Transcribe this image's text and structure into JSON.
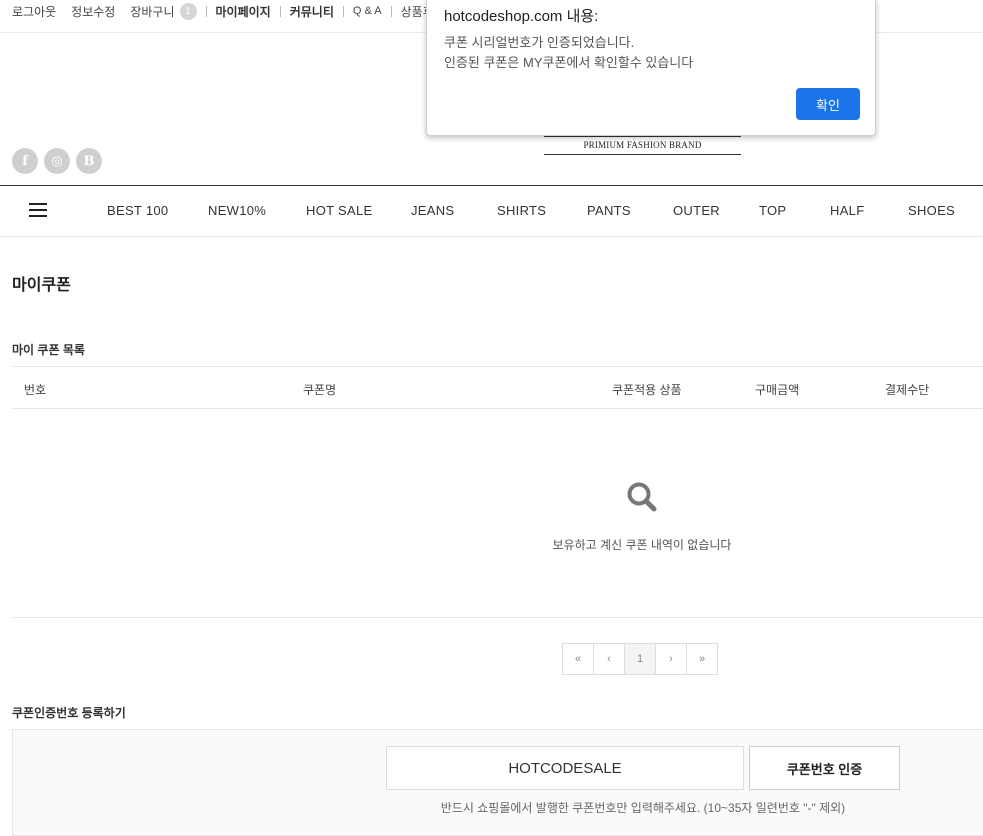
{
  "topbar": {
    "logout": "로그아웃",
    "edit_info": "정보수정",
    "cart": "장바구니",
    "cart_count": "1",
    "mypage": "마이페이지",
    "community": "커뮤니티",
    "qna": "Q & A",
    "product_partial": "상품후"
  },
  "header": {
    "social": [
      "f",
      "◎",
      "B"
    ],
    "brand_tagline": "PRIMIUM FASHION BRAND"
  },
  "nav": {
    "items": [
      "BEST 100",
      "NEW10%",
      "HOT SALE",
      "JEANS",
      "SHIRTS",
      "PANTS",
      "OUTER",
      "TOP",
      "HALF",
      "SHOES"
    ]
  },
  "page": {
    "title": "마이쿠폰",
    "list_title": "마이 쿠폰 목록",
    "columns": [
      "번호",
      "쿠폰명",
      "쿠폰적용 상품",
      "구매금액",
      "결제수단"
    ],
    "empty_message": "보유하고 계신 쿠폰 내역이 없습니다"
  },
  "pagination": {
    "first": "«",
    "prev": "‹",
    "current": "1",
    "next": "›",
    "last": "»"
  },
  "register": {
    "title": "쿠폰인증번호 등록하기",
    "input_value": "HOTCODESALE",
    "button_label": "쿠폰번호 인증",
    "note": "반드시 쇼핑몰에서 발행한 쿠폰번호만 입력해주세요. (10~35자 일련번호 \"-\" 제외)"
  },
  "dialog": {
    "title": "hotcodeshop.com 내용:",
    "line1": "쿠폰 시리얼번호가 인증되었습니다.",
    "line2": "인증된 쿠폰은 MY쿠폰에서 확인할수 있습니다",
    "ok_label": "확인",
    "button_color": "#1a73e8"
  }
}
